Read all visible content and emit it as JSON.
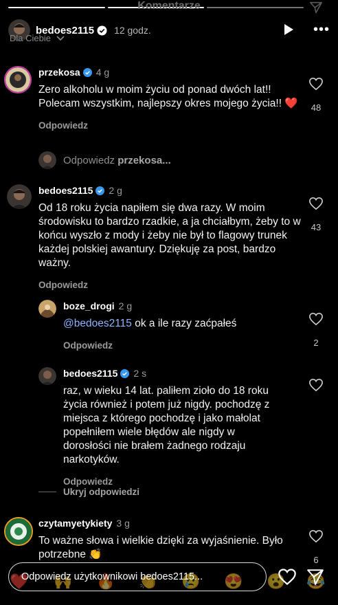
{
  "sheet": {
    "title": "Komentarze"
  },
  "story": {
    "username": "bedoes2115",
    "time": "12 godz.",
    "more_glyph": "•••",
    "filter_label": "Dla Ciebie",
    "progress_segments": 3
  },
  "comments": [
    {
      "username": "przekosa",
      "age": "4 g",
      "verified": true,
      "text": "Zero alkoholu w moim życiu od ponad dwóch lat!! Polecam wszystkim, najlepszy okres mojego życia!! ❤️",
      "likes": "48",
      "reply_label": "Odpowiedz"
    },
    {
      "username": "bedoes2115",
      "age": "2 g",
      "verified": true,
      "text": "Od 18 roku życia napiłem się dwa razy. W moim środowisku to bardzo rzadkie, a ja chciałbym, żeby to w końcu wyszło z mody i żeby nie był to flagowy trunek każdej polskiej awantury. Dziękuję za post, bardzo ważny.",
      "likes": "43",
      "reply_label": "Odpowiedz"
    },
    {
      "username": "boze_drogi",
      "age": "2 g",
      "verified": false,
      "mention": "@bedoes2115",
      "text": " ok a ile razy zaćpałeś",
      "likes": "2",
      "reply_label": "Odpowiedz"
    },
    {
      "username": "bedoes2115",
      "age": "2 s",
      "verified": true,
      "text": "raz, w wieku 14 lat. paliłem zioło do 18 roku życia również i potem już nigdy. pochodzę z miejsca z którego pochodzę i jako małolat popełniłem wiele błędów ale nigdy w dorosłości nie brałem żadnego rodzaju narkotyków.",
      "likes": "",
      "reply_label": "Odpowiedz"
    },
    {
      "username": "czytamyetykiety",
      "age": "3 g",
      "verified": false,
      "text": "To ważne słowa i wielkie dzięki za wyjaśnienie. Było potrzebne 👏",
      "likes": "6",
      "reply_label": ""
    }
  ],
  "reply_prompt": {
    "prefix": "Odpowiedz",
    "username": "przekosa..."
  },
  "hide_replies_label": "Ukryj odpowiedzi",
  "input": {
    "placeholder": "Odpowiedz użytkownikowi bedoes2115..."
  },
  "emoji_suggestions": [
    "❤️",
    "🙌",
    "🔥",
    "👏",
    "😢",
    "😍",
    "😮",
    "😂"
  ],
  "colors": {
    "background": "#000000",
    "verified": "#3897f0",
    "mention": "#8fb3ff",
    "muted": "#9b9b9b"
  },
  "icons": [
    "send-icon",
    "play-icon",
    "more-icon",
    "chevron-down-icon",
    "heart-icon",
    "verified-badge-icon"
  ]
}
